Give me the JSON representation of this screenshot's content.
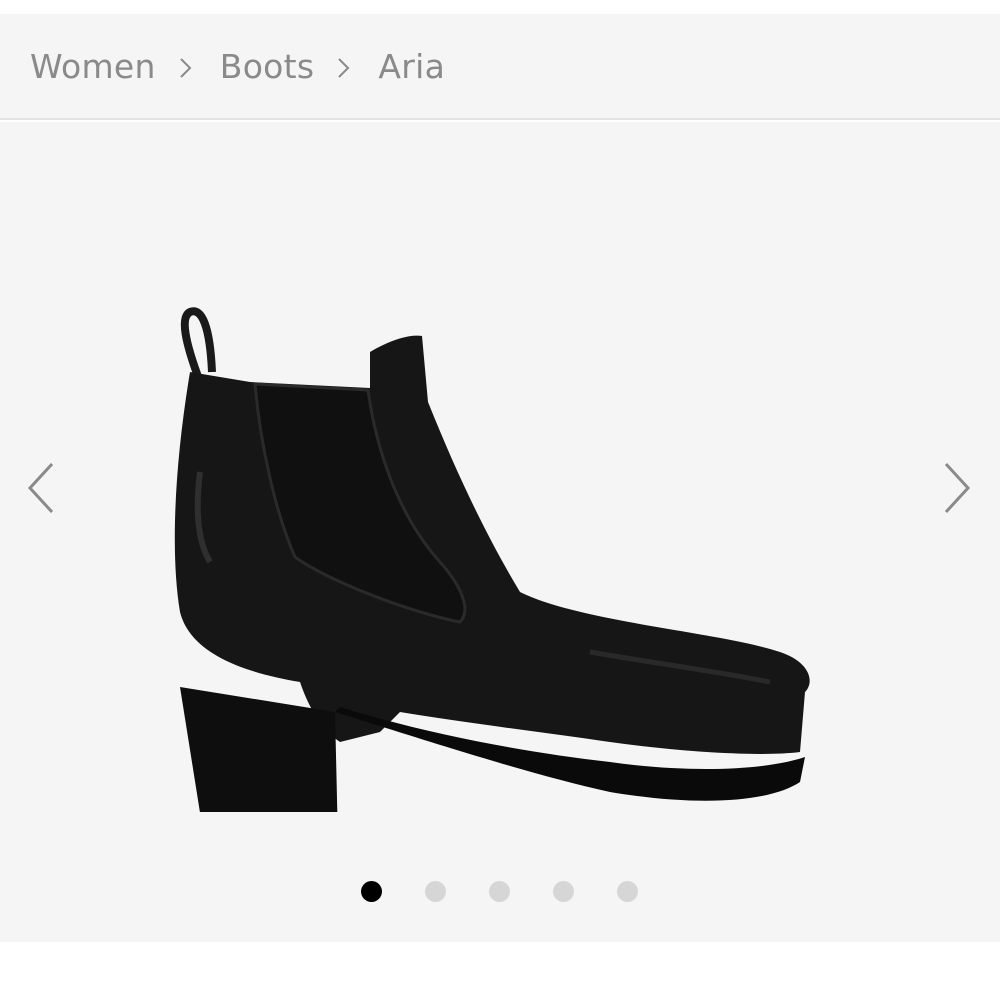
{
  "breadcrumb": {
    "items": [
      {
        "label": "Women"
      },
      {
        "label": "Boots"
      },
      {
        "label": "Aria"
      }
    ],
    "separator_icon": "chevron-right-icon"
  },
  "gallery": {
    "prev_icon": "chevron-left-icon",
    "next_icon": "chevron-right-icon",
    "image_count": 5,
    "active_index": 1,
    "image_subject": "black leather chelsea ankle boot with block heel"
  },
  "colors": {
    "background": "#f5f5f5",
    "text_muted": "#8a8a8a",
    "dot_active": "#000000",
    "dot_inactive": "#d6d6d6"
  }
}
